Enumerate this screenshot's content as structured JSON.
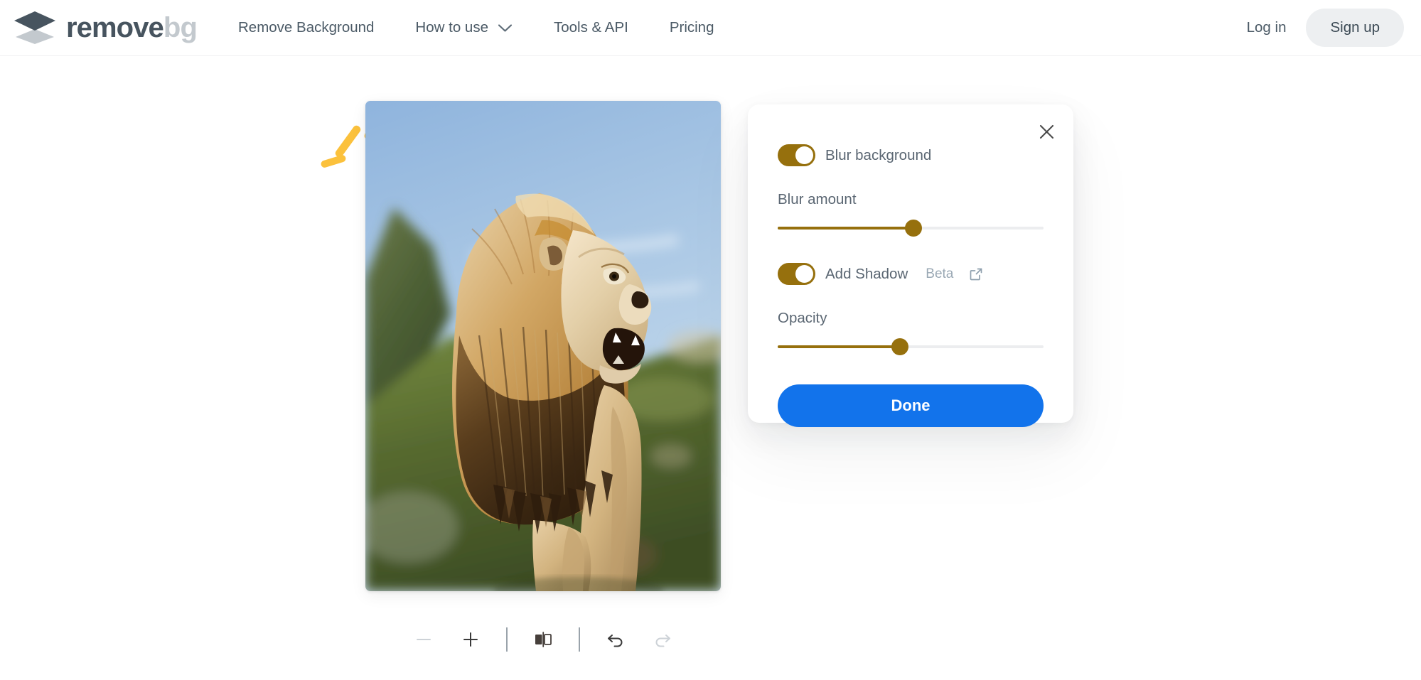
{
  "header": {
    "logo": {
      "icon": "layers-diamond-icon",
      "primary": "remove",
      "secondary": "bg"
    },
    "nav": [
      {
        "label": "Remove Background",
        "icon": null
      },
      {
        "label": "How to use",
        "icon": "chevron-down-icon"
      },
      {
        "label": "Tools & API",
        "icon": null
      },
      {
        "label": "Pricing",
        "icon": null
      }
    ],
    "login_label": "Log in",
    "signup_label": "Sign up"
  },
  "editor": {
    "image_alt": "Lion roaring on a grassy hillside with blue sky",
    "decoration": "sparkle-icon"
  },
  "panel": {
    "close_icon": "close-icon",
    "blur_background": {
      "label": "Blur background",
      "toggle_state": "on",
      "slider_label": "Blur amount",
      "slider_value": 51
    },
    "add_shadow": {
      "label": "Add Shadow",
      "badge": "Beta",
      "badge_icon": "external-link-icon",
      "toggle_state": "on",
      "slider_label": "Opacity",
      "slider_value": 46
    },
    "done_label": "Done"
  },
  "toolbar": {
    "buttons": [
      {
        "name": "zoom-out",
        "icon": "minus-icon",
        "enabled": false
      },
      {
        "name": "zoom-in",
        "icon": "plus-icon",
        "enabled": true
      },
      {
        "name": "compare",
        "icon": "compare-split-icon",
        "enabled": true
      },
      {
        "name": "undo",
        "icon": "undo-arrow-icon",
        "enabled": true
      },
      {
        "name": "redo",
        "icon": "redo-arrow-icon",
        "enabled": false
      }
    ]
  },
  "colors": {
    "accent_gold": "#96700d",
    "primary_blue": "#1273eb",
    "logo_dark": "#47545f",
    "logo_light": "#c3c9ce",
    "text_gray": "#5a6672",
    "disabled_gray": "#c9ced3",
    "sparkle_yellow": "#fbc13c"
  }
}
